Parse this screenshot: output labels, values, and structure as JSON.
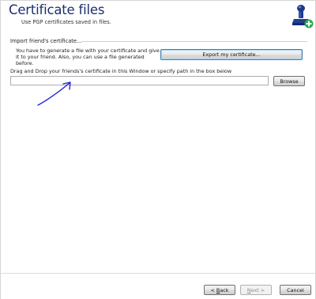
{
  "header": {
    "title": "Certificate files",
    "subtitle": "Use PGP certificates saved in files."
  },
  "import_section": {
    "group_title": "Import friend's certificate...",
    "description": "You have to generate a file with your certificate and give it to your friend. Also, you can use a file generated before.",
    "export_button": "Export my certificate...",
    "drag_drop_label": "Drag and Drop your friends's certificate in this Window or specify path in the box below",
    "path_input_value": "",
    "browse_button": "Browse"
  },
  "footer": {
    "back_prefix": "< ",
    "back_mnemonic": "B",
    "back_rest": "ack",
    "next_mnemonic": "N",
    "next_rest": "ext",
    "next_suffix": " >",
    "cancel_button": "Cancel"
  },
  "colors": {
    "title": "#1b2f6f",
    "annotation_arrow": "#1a1ad6",
    "stamp_handle": "#1e3a8a",
    "plus_green": "#2fa84f"
  },
  "icons": {
    "header_icon": "certificate-stamp-plus-icon"
  }
}
